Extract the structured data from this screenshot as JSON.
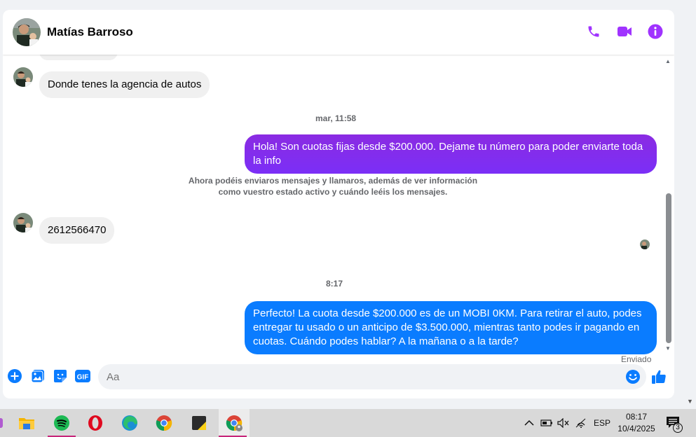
{
  "header": {
    "contact_name": "Matías Barroso",
    "actions": [
      "phone-icon",
      "video-icon",
      "info-icon"
    ],
    "accent_color": "#a033ff"
  },
  "messages": {
    "incoming_1": "Donde tenes la agencia de autos",
    "time_1": "mar, 11:58",
    "outgoing_1": "Hola! Son cuotas fijas desde $200.000. Dejame tu número para poder enviarte toda la info",
    "notice": "Ahora podéis enviaros mensajes y llamaros, además de ver información como vuestro estado activo y cuándo leéis los mensajes.",
    "incoming_2": "2612566470",
    "time_2": "8:17",
    "outgoing_2": "Perfecto! La cuota desde $200.000 es de un MOBI 0KM. Para retirar el auto, podes entregar tu usado o un anticipo de $3.500.000, mientras tanto podes ir pagando en cuotas. Cuándo podes hablar? A la mañana o a la tarde?",
    "status": "Enviado"
  },
  "composer": {
    "placeholder": "Aa",
    "tools": [
      "add-icon",
      "gallery-icon",
      "sticker-icon",
      "gif-icon"
    ],
    "gif_label": "GIF"
  },
  "taskbar": {
    "apps": [
      "file-explorer",
      "spotify",
      "opera",
      "edge",
      "chrome",
      "sticky-notes",
      "chrome-profile"
    ],
    "language": "ESP",
    "time": "08:17",
    "date": "10/4/2025",
    "notification_count": "3"
  }
}
